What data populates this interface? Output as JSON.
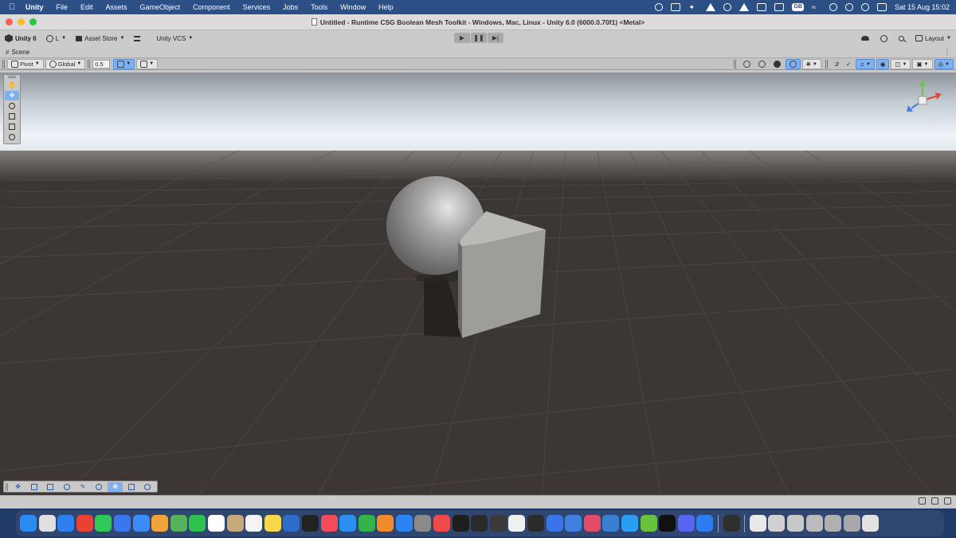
{
  "menubar": {
    "app_name": "Unity",
    "items": [
      "File",
      "Edit",
      "Assets",
      "GameObject",
      "Component",
      "Services",
      "Jobs",
      "Tools",
      "Window",
      "Help"
    ],
    "status_icons": [
      "network-icon",
      "screen-icon",
      "sparkle-icon",
      "pen-icon",
      "record-icon",
      "airplay-icon",
      "flag-icon",
      "display-icon",
      "gb-badge",
      "wifi-icon",
      "search-icon",
      "user-icon",
      "play-circle-icon",
      "control-center-icon"
    ],
    "keyboard_badge": "GB",
    "clock": "Sat 15 Aug  15:02"
  },
  "window": {
    "title": "Untitled - Runtime CSG Boolean Mesh Toolkit - Windows, Mac, Linux - Unity 6.0 (6000.0.70f1) <Metal>"
  },
  "toolbar": {
    "unity_label": "Unity 6",
    "account_label": "L",
    "asset_store_label": "Asset Store",
    "vcs_label": "Unity VCS",
    "layout_label": "Layout"
  },
  "scene": {
    "tab_label": "Scene",
    "pivot_label": "Pivot",
    "global_label": "Global",
    "grid_snap_value": "0.5"
  },
  "colors": {
    "accent_blue": "#7fb0f0",
    "sky_top": "#eef4fa",
    "ground": "#3c3734"
  },
  "dock": {
    "apps": [
      {
        "name": "finder",
        "color": "#2a8cf0"
      },
      {
        "name": "launchpad",
        "color": "#e0e0e0"
      },
      {
        "name": "safari",
        "color": "#2f7ff0"
      },
      {
        "name": "chrome",
        "color": "#e94235"
      },
      {
        "name": "messages",
        "color": "#31c85a"
      },
      {
        "name": "signal",
        "color": "#3a76f0"
      },
      {
        "name": "mail",
        "color": "#3d8bf5"
      },
      {
        "name": "photos",
        "color": "#f2a33a"
      },
      {
        "name": "maps",
        "color": "#57b05b"
      },
      {
        "name": "facetime",
        "color": "#2fc14f"
      },
      {
        "name": "calendar",
        "color": "#ffffff"
      },
      {
        "name": "contacts",
        "color": "#c9a97a"
      },
      {
        "name": "reminders",
        "color": "#f4f4f4"
      },
      {
        "name": "notes",
        "color": "#f8d74a"
      },
      {
        "name": "freeform",
        "color": "#2d6cc8"
      },
      {
        "name": "tv",
        "color": "#222222"
      },
      {
        "name": "music",
        "color": "#f24c5b"
      },
      {
        "name": "keynote",
        "color": "#2b8ef0"
      },
      {
        "name": "numbers",
        "color": "#34b34a"
      },
      {
        "name": "pages",
        "color": "#f08b2a"
      },
      {
        "name": "app-store",
        "color": "#2b84f2"
      },
      {
        "name": "system-settings",
        "color": "#8a8a8a"
      },
      {
        "name": "news",
        "color": "#f04a4a"
      },
      {
        "name": "terminal",
        "color": "#1e1e1e"
      },
      {
        "name": "chatgpt",
        "color": "#2a2a2a"
      },
      {
        "name": "openai",
        "color": "#3a3a3a"
      },
      {
        "name": "arc",
        "color": "#f0f0f0"
      },
      {
        "name": "unity-hub",
        "color": "#2b2b2b"
      },
      {
        "name": "gemini",
        "color": "#3b74e6"
      },
      {
        "name": "preview",
        "color": "#3f7fe0"
      },
      {
        "name": "screenshot",
        "color": "#e24a6a"
      },
      {
        "name": "xcode",
        "color": "#3a7fd4"
      },
      {
        "name": "cursor",
        "color": "#2a9ef0"
      },
      {
        "name": "android-studio",
        "color": "#6ac13c"
      },
      {
        "name": "copilot",
        "color": "#111111"
      },
      {
        "name": "discord",
        "color": "#5865f2"
      },
      {
        "name": "testflight",
        "color": "#2a7ef0"
      },
      {
        "name": "unity",
        "color": "#2f2f2f"
      },
      {
        "name": "downloads",
        "color": "#e8e8e8"
      },
      {
        "name": "recent-1",
        "color": "#d0d0d0"
      },
      {
        "name": "recent-2",
        "color": "#c8c8c8"
      },
      {
        "name": "recent-3",
        "color": "#bcbcbc"
      },
      {
        "name": "recent-4",
        "color": "#b0b0b0"
      },
      {
        "name": "recent-5",
        "color": "#a8a8a8"
      },
      {
        "name": "trash",
        "color": "#e2e2e2"
      }
    ]
  }
}
